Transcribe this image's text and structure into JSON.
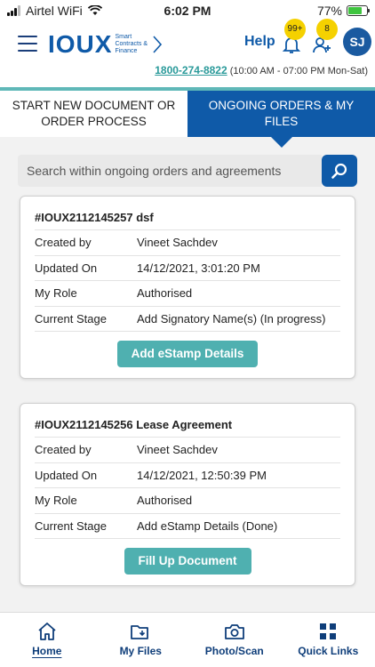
{
  "status_bar": {
    "carrier": "Airtel WiFi",
    "time": "6:02 PM",
    "battery": "77%",
    "battery_level": 0.77
  },
  "header": {
    "logo_text": "IOUX",
    "logo_tagline": "Smart Contracts & Finance",
    "help_label": "Help",
    "notifications_badge": "99+",
    "user_requests_badge": "8",
    "avatar_initials": "SJ",
    "phone": "1800-274-8822",
    "hours": "(10:00 AM - 07:00 PM Mon-Sat)"
  },
  "tabs": [
    {
      "label": "START NEW DOCUMENT OR ORDER PROCESS"
    },
    {
      "label": "ONGOING ORDERS & MY FILES"
    }
  ],
  "search": {
    "placeholder": "Search within ongoing orders and agreements"
  },
  "orders": [
    {
      "title": "#IOUX2112145257 dsf",
      "rows": [
        {
          "k": "Created by",
          "v": "Vineet Sachdev"
        },
        {
          "k": "Updated On",
          "v": "14/12/2021, 3:01:20 PM"
        },
        {
          "k": "My Role",
          "v": "Authorised"
        },
        {
          "k": "Current Stage",
          "v": "Add Signatory Name(s) (In progress)"
        }
      ],
      "action": "Add eStamp Details"
    },
    {
      "title": "#IOUX2112145256 Lease Agreement",
      "rows": [
        {
          "k": "Created by",
          "v": "Vineet Sachdev"
        },
        {
          "k": "Updated On",
          "v": "14/12/2021, 12:50:39 PM"
        },
        {
          "k": "My Role",
          "v": "Authorised"
        },
        {
          "k": "Current Stage",
          "v": "Add eStamp Details (Done)"
        }
      ],
      "action": "Fill Up Document"
    }
  ],
  "bottom_nav": [
    {
      "label": "Home",
      "icon": "home-icon"
    },
    {
      "label": "My Files",
      "icon": "folder-icon"
    },
    {
      "label": "Photo/Scan",
      "icon": "camera-icon"
    },
    {
      "label": "Quick Links",
      "icon": "grid-icon"
    }
  ],
  "colors": {
    "brand_blue": "#0f5aa8",
    "teal": "#4fb0b0",
    "badge_yellow": "#f5d100"
  }
}
